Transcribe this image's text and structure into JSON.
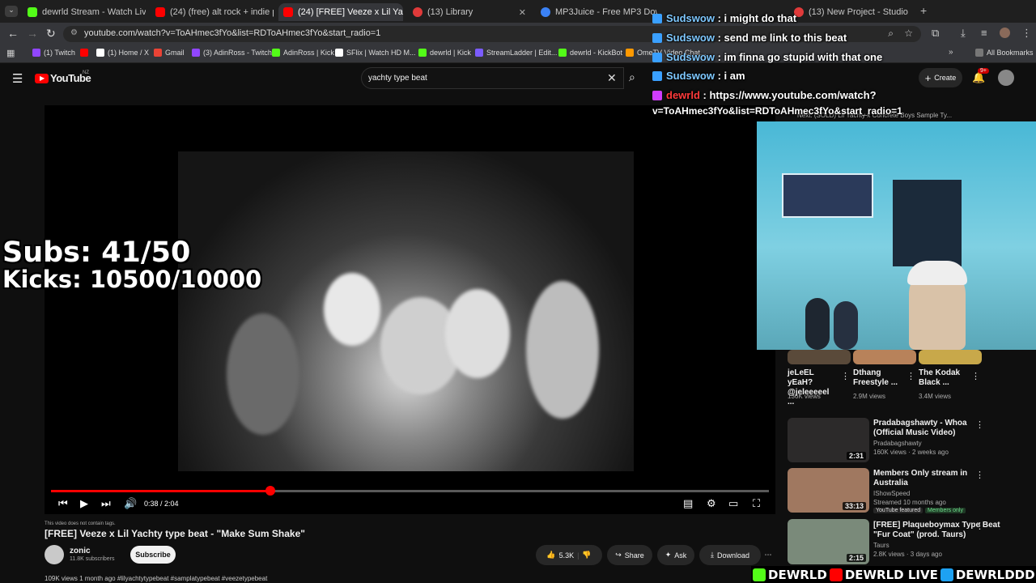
{
  "tabs": [
    {
      "label": "dewrld Stream - Watch Live on",
      "color": "#53fc18"
    },
    {
      "label": "(24) (free) alt rock + indie pop",
      "color": "#ff0000"
    },
    {
      "label": "(24) [FREE] Veeze x Lil Yachty ty",
      "color": "#ff0000"
    },
    {
      "label": "(13) Library",
      "color": "#e03a3a"
    },
    {
      "label": "MP3Juice - Free MP3 Download",
      "color": "#3b82f6"
    },
    {
      "label": "(13) New Project - Studio",
      "color": "#e03a3a"
    },
    {
      "label": "(13) New Project - Studio",
      "color": "#e03a3a"
    }
  ],
  "url": "youtube.com/watch?v=ToAHmec3fYo&list=RDToAHmec3fYo&start_radio=1",
  "bookmarks": [
    {
      "label": "(1) Twitch",
      "color": "#9146ff"
    },
    {
      "label": "",
      "color": "#ff0000"
    },
    {
      "label": "(1) Home / X",
      "color": "#ffffff"
    },
    {
      "label": "Gmail",
      "color": "#ea4335"
    },
    {
      "label": "(3) AdinRoss - Twitch",
      "color": "#9146ff"
    },
    {
      "label": "AdinRoss | Kick",
      "color": "#53fc18"
    },
    {
      "label": "SFlix | Watch HD M...",
      "color": "#ffffff"
    },
    {
      "label": "dewrld | Kick",
      "color": "#53fc18"
    },
    {
      "label": "StreamLadder | Edit...",
      "color": "#7b5cff"
    },
    {
      "label": "dewrld - KickBot",
      "color": "#53fc18"
    },
    {
      "label": "OmeTV Video Chat...",
      "color": "#ff9900"
    }
  ],
  "all_bookmarks": "All Bookmarks",
  "youtube": {
    "logo": "YouTube",
    "region": "NZ",
    "search_value": "yachty type beat",
    "create": "Create",
    "notif_count": "9+"
  },
  "overlay": {
    "subs": "Subs: 41/50",
    "kicks": "Kicks: 10500/10000"
  },
  "chat": [
    {
      "user": "Sudswow",
      "msg": " : i might do that"
    },
    {
      "user": "Sudswow",
      "msg": " : send me link to this beat"
    },
    {
      "user": "Sudswow",
      "msg": " : im finna go stupid with that one"
    },
    {
      "user": "Sudswow",
      "msg": " : i am"
    },
    {
      "user": "dewrld",
      "msg": " : https://www.youtube.com/watch?"
    }
  ],
  "chat_link_cont": "v=ToAHmec3fYo&list=RDToAHmec3fYo&start_radio=1",
  "next_up": "Next: (SOLD) Lil Yachty x Concrete Boys Sample Ty...",
  "player": {
    "time": "0:38 / 2:04",
    "progress": 0.306
  },
  "video": {
    "notice": "This video does not contain tags.",
    "title": "[FREE] Veeze x Lil Yachty type beat - \"Make Sum Shake\"",
    "channel": "zonic",
    "subscribers": "11.8K subscribers",
    "subscribe": "Subscribe",
    "likes": "5.3K",
    "share": "Share",
    "ask": "Ask",
    "download": "Download",
    "meta": "109K views  1 month ago  #lilyachtytypebeat #samplatypebeat #veezetypebeat"
  },
  "recs_top": [
    {
      "title": "jeLeEL yEaH? @jeleeeeel ...",
      "meta": "136K views"
    },
    {
      "title": "Dthang Freestyle ...",
      "meta": "2.9M views"
    },
    {
      "title": "The Kodak Black ...",
      "meta": "3.4M views"
    }
  ],
  "recs": [
    {
      "title1": "Pradabagshawty - Whoa",
      "title2": "(Official Music Video)",
      "channel": "Pradabagshawty",
      "meta": "160K views · 2 weeks ago",
      "duration": "2:31",
      "color": "#2c2a2a"
    },
    {
      "title1": "Members Only stream in",
      "title2": "Australia",
      "channel": "IShowSpeed",
      "meta": "Streamed 10 months ago",
      "duration": "33:13",
      "badge1": "YouTube featured",
      "badge2": "Members only",
      "color": "#a07860"
    },
    {
      "title1": "[FREE] Plaqueboymax Type Beat",
      "title2": "\"Fur Coat\" (prod. Taurs)",
      "channel": "Taurs",
      "meta": "2.8K views · 3 days ago",
      "duration": "2:15",
      "color": "#7a8a7a"
    }
  ],
  "brand": [
    "DEWRLD",
    "DEWRLD LIVE",
    "DEWRLDDD"
  ]
}
